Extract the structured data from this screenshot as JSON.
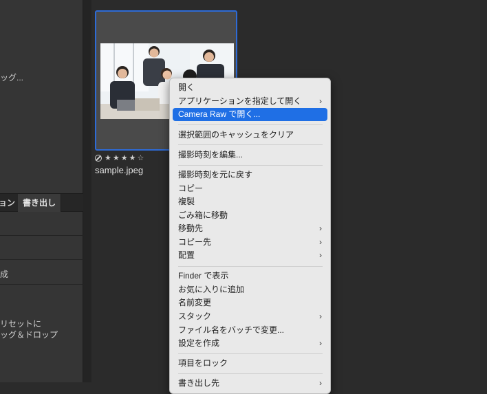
{
  "left_panel": {
    "top_text": "ッグ...",
    "tabs": {
      "partial": "ョン",
      "export": "書き出し"
    },
    "row_items": [
      "成",
      "リセットに",
      "ッグ＆ドロップ"
    ]
  },
  "thumbnail": {
    "rating_stars": [
      "★",
      "★",
      "★",
      "★",
      "☆"
    ],
    "filename": "sample.jpeg"
  },
  "context_menu": {
    "items": [
      "開く",
      "アプリケーションを指定して開く",
      "Camera Raw で開く...",
      "選択範囲のキャッシュをクリア",
      "撮影時刻を編集...",
      "撮影時刻を元に戻す",
      "コピー",
      "複製",
      "ごみ箱に移動",
      "移動先",
      "コピー先",
      "配置",
      "Finder で表示",
      "お気に入りに追加",
      "名前変更",
      "スタック",
      "ファイル名をバッチで変更...",
      "設定を作成",
      "項目をロック",
      "書き出し先"
    ],
    "chevron": "›"
  },
  "colors": {
    "accent": "#1f6fe5",
    "selection_border": "#2e6bd6",
    "background": "#2b2b2b",
    "menu_background": "#e9e9e9"
  }
}
